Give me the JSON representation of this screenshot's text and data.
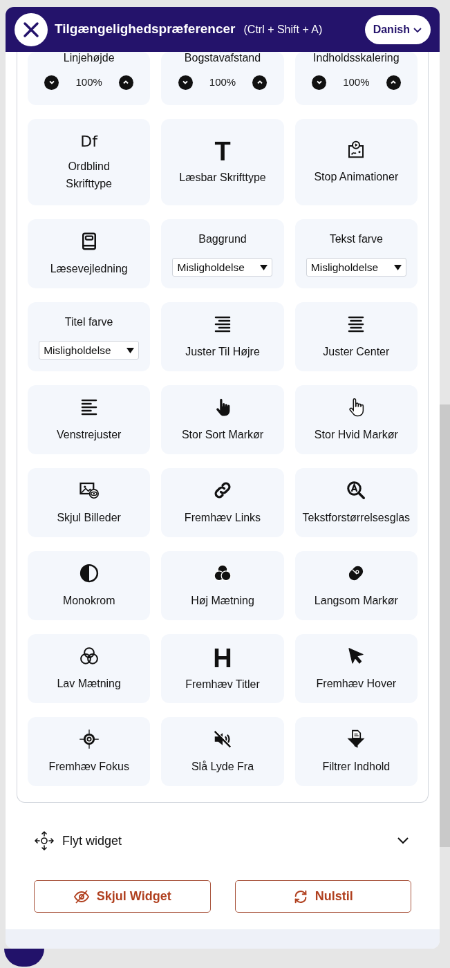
{
  "header": {
    "title": "Tilgængelighedspræferencer",
    "shortcut": "(Ctrl + Shift + A)",
    "language": "Danish"
  },
  "tiles": [
    {
      "kind": "stepper",
      "label": "Linjehøjde",
      "value": "100%"
    },
    {
      "kind": "stepper",
      "label": "Bogstavafstand",
      "value": "100%"
    },
    {
      "kind": "stepper",
      "label": "Indholdsskalering",
      "value": "100%"
    },
    {
      "kind": "toggle",
      "glyph": "Df",
      "label": "Ordblind Skrifttype"
    },
    {
      "kind": "toggle",
      "glyph": "T",
      "label": "Læsbar Skrifttype"
    },
    {
      "kind": "toggle",
      "label": "Stop Animationer"
    },
    {
      "kind": "toggle",
      "label": "Læsevejledning"
    },
    {
      "kind": "select",
      "label": "Baggrund",
      "value": "Misligholdelse"
    },
    {
      "kind": "select",
      "label": "Tekst farve",
      "value": "Misligholdelse"
    },
    {
      "kind": "select",
      "label": "Titel farve",
      "value": "Misligholdelse"
    },
    {
      "kind": "toggle",
      "label": "Juster Til Højre"
    },
    {
      "kind": "toggle",
      "label": "Juster Center"
    },
    {
      "kind": "toggle",
      "label": "Venstrejuster"
    },
    {
      "kind": "toggle",
      "label": "Stor Sort Markør"
    },
    {
      "kind": "toggle",
      "label": "Stor Hvid Markør"
    },
    {
      "kind": "toggle",
      "label": "Skjul Billeder"
    },
    {
      "kind": "toggle",
      "label": "Fremhæv Links"
    },
    {
      "kind": "toggle",
      "label": "Tekstforstørrelsesglas"
    },
    {
      "kind": "toggle",
      "label": "Monokrom"
    },
    {
      "kind": "toggle",
      "label": "Høj Mætning"
    },
    {
      "kind": "toggle",
      "label": "Langsom Markør"
    },
    {
      "kind": "toggle",
      "label": "Lav Mætning"
    },
    {
      "kind": "toggle",
      "glyph": "H",
      "label": "Fremhæv Titler"
    },
    {
      "kind": "toggle",
      "label": "Fremhæv Hover"
    },
    {
      "kind": "toggle",
      "label": "Fremhæv Fokus"
    },
    {
      "kind": "toggle",
      "label": "Slå Lyde Fra"
    },
    {
      "kind": "toggle",
      "label": "Filtrer Indhold"
    }
  ],
  "move_widget": {
    "label": "Flyt widget",
    "expanded": false
  },
  "buttons": [
    {
      "kind": "hide",
      "label": "Skjul Widget"
    },
    {
      "kind": "reset",
      "label": "Nulstil"
    }
  ]
}
